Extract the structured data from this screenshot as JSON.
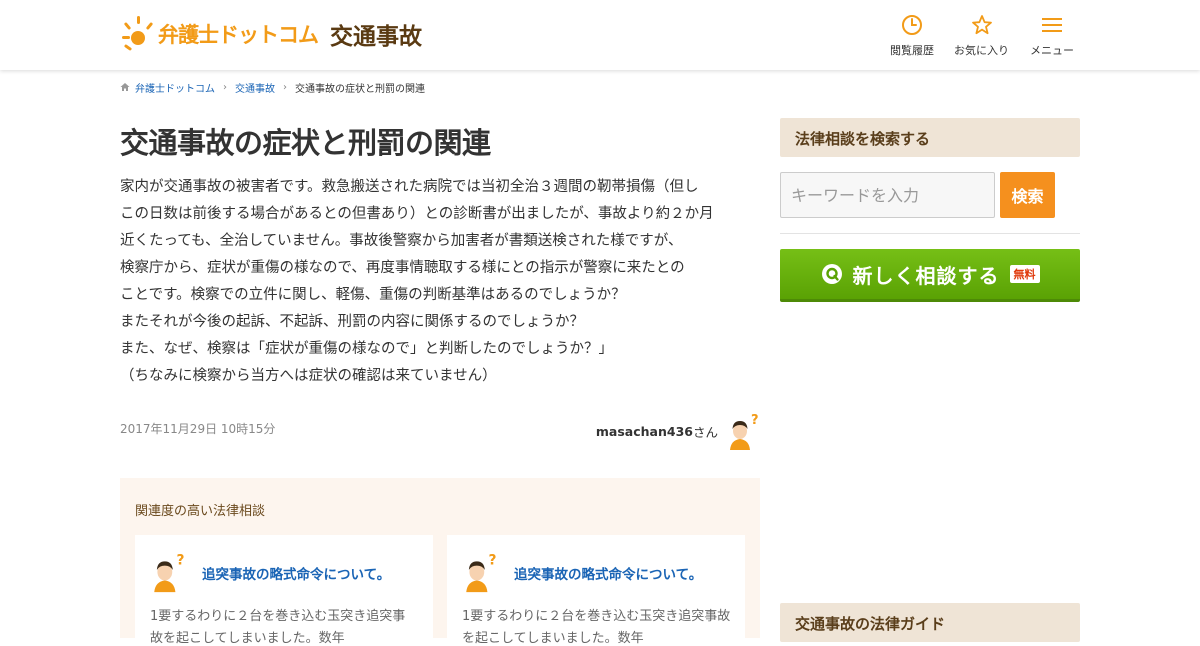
{
  "header": {
    "logo_text": "弁護士ドットコム",
    "category": "交通事故",
    "nav": [
      {
        "label": "閲覧履歴",
        "icon": "clock-icon"
      },
      {
        "label": "お気に入り",
        "icon": "star-icon"
      },
      {
        "label": "メニュー",
        "icon": "menu-icon"
      }
    ]
  },
  "breadcrumb": {
    "home_icon": "home-icon",
    "items": [
      "弁護士ドットコム",
      "交通事故",
      "交通事故の症状と刑罰の関連"
    ]
  },
  "question": {
    "title": "交通事故の症状と刑罰の関連",
    "lines": [
      "家内が交通事故の被害者です。救急搬送された病院では当初全治３週間の靭帯損傷（但し",
      "この日数は前後する場合があるとの但書あり）との診断書が出ましたが、事故より約２か月",
      "近くたっても、全治していません。事故後警察から加害者が書類送検された様ですが、",
      "検察庁から、症状が重傷の様なので、再度事情聴取する様にとの指示が警察に来たとの",
      "ことです。検察での立件に関し、軽傷、重傷の判断基準はあるのでしょうか？",
      "またそれが今後の起訴、不起訴、刑罰の内容に関係するのでしょうか？",
      "また、なぜ、検察は「症状が重傷の様なので」と判断したのでしょうか？」",
      "（ちなみに検察から当方へは症状の確認は来ていません）"
    ],
    "date": "2017年11月29日 10時15分",
    "asker_name": "masachan436",
    "asker_suffix": "さん"
  },
  "related": {
    "heading": "関連度の高い法律相談",
    "cards": [
      {
        "title": "追突事故の略式命令について。",
        "excerpt": "1要するわりに２台を巻き込む玉突き追突事",
        "excerpt2": "故を起こしてしまいました。数年"
      },
      {
        "title": "追突事故の略式命令について。",
        "excerpt": "1要するわりに２台を巻き込む玉突き追突事故",
        "excerpt2": "を起こしてしまいました。数年"
      }
    ]
  },
  "sidebar": {
    "search_heading": "法律相談を検索する",
    "search_placeholder": "キーワードを入力",
    "search_button": "検索",
    "consult_label": "新しく相談する",
    "consult_badge": "無料",
    "guide_heading": "交通事故の法律ガイド"
  },
  "colors": {
    "brand_orange": "#f29b18",
    "link_blue": "#1a64b5",
    "consult_green": "#5aa204",
    "sidebar_head_bg": "#efe4d6"
  }
}
